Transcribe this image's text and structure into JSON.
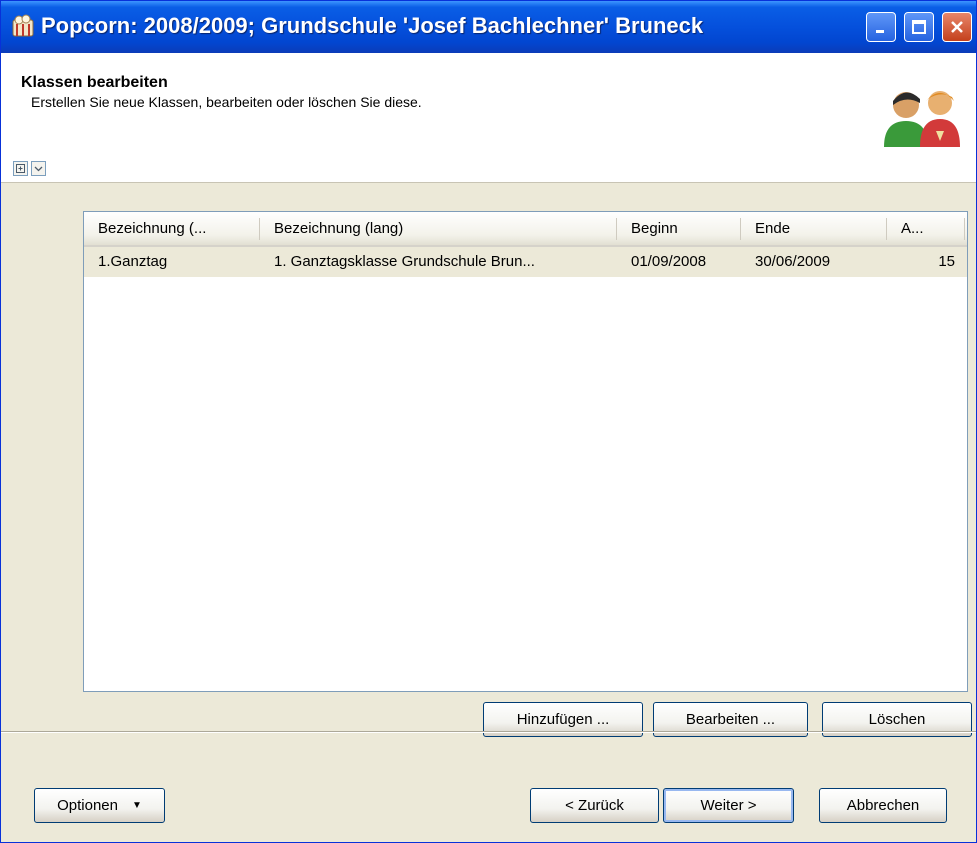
{
  "window": {
    "title": "Popcorn: 2008/2009; Grundschule 'Josef Bachlechner' Bruneck"
  },
  "header": {
    "title": "Klassen bearbeiten",
    "subtitle": "Erstellen Sie neue Klassen, bearbeiten oder löschen Sie diese.",
    "icon": "people-icon"
  },
  "listview": {
    "columns": [
      "Bezeichnung (...",
      "Bezeichnung (lang)",
      "Beginn",
      "Ende",
      "A..."
    ],
    "rows": [
      [
        "1.Ganztag",
        "1. Ganztagsklasse Grundschule Brun...",
        "01/09/2008",
        "30/06/2009",
        "15"
      ]
    ]
  },
  "list_buttons": {
    "add": "Hinzufügen ...",
    "edit": "Bearbeiten ...",
    "delete": "Löschen"
  },
  "footer": {
    "options": "Optionen",
    "back": "< Zurück",
    "next": "Weiter >",
    "cancel": "Abbrechen"
  },
  "colors": {
    "titlebar": "#0550dc",
    "dialog_bg": "#ece9d8",
    "selected_row": "#ece9d8"
  }
}
